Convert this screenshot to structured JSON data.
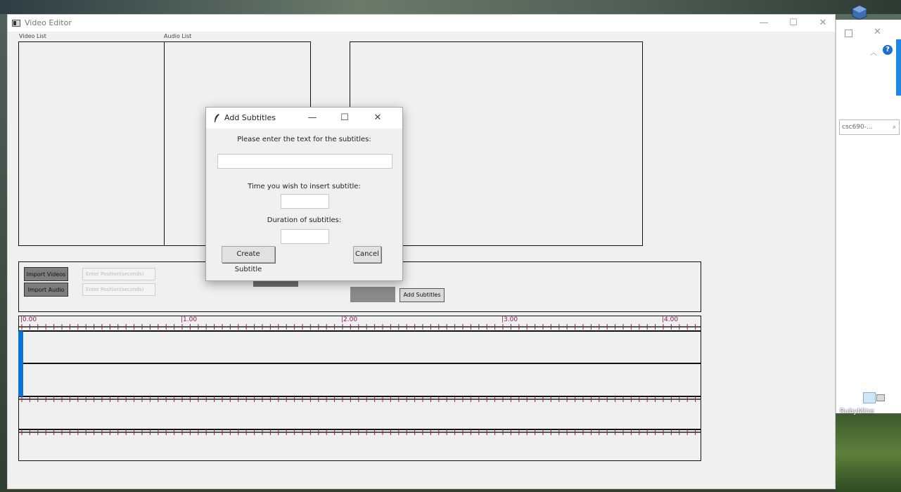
{
  "window": {
    "title": "Video Editor"
  },
  "lists": {
    "video_label": "Video List",
    "audio_label": "Audio List"
  },
  "controls": {
    "import_videos": "Import Videos",
    "import_audio": "Import Audio",
    "video_position_placeholder": "Enter Position(seconds)",
    "audio_position_placeholder": "Enter Position(seconds)",
    "add_subtitles": "Add Subtitles"
  },
  "timeline": {
    "tick_labels": [
      "|0.00",
      "|1.00",
      "|2.00",
      "|3.00",
      "|4.00"
    ]
  },
  "dialog": {
    "title": "Add Subtitles",
    "text_prompt": "Please enter the text for the subtitles:",
    "time_prompt": "Time you wish to insert subtitle:",
    "duration_prompt": "Duration of subtitles:",
    "create_button": "Create Subtitle",
    "cancel_button": "Cancel",
    "text_value": "",
    "time_value": "",
    "duration_value": ""
  },
  "background_window": {
    "search_text": "csc690-...",
    "taskbar_label": "RubyMine"
  },
  "colors": {
    "accent_blue": "#0a74d8",
    "tick_color": "#8a1d5a"
  },
  "icons": {
    "app": "app-window-icon",
    "dialog": "feather-icon",
    "minimize": "minimize-icon",
    "maximize": "maximize-icon",
    "close": "close-icon"
  }
}
